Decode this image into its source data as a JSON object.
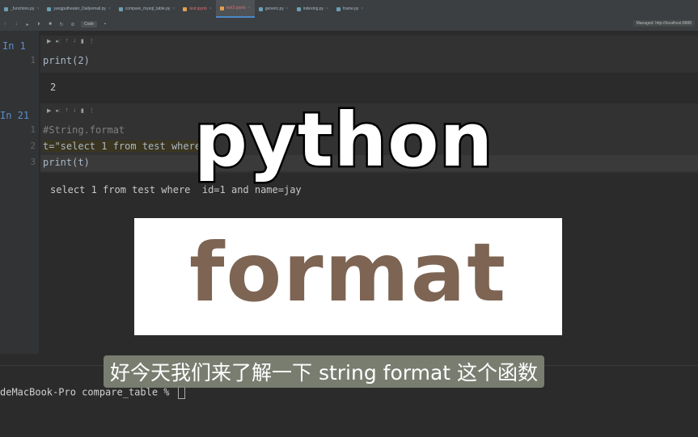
{
  "tabs": [
    {
      "label": "_functions.py",
      "state": "normal"
    },
    {
      "label": "yangputheater_Dailyemail.py",
      "state": "normal"
    },
    {
      "label": "compare_mysql_table.py",
      "state": "normal"
    },
    {
      "label": "test.ipynb",
      "state": "error"
    },
    {
      "label": "test2.ipynb",
      "state": "active"
    },
    {
      "label": "generic.py",
      "state": "normal"
    },
    {
      "label": "indexing.py",
      "state": "normal"
    },
    {
      "label": "frame.py",
      "state": "normal"
    }
  ],
  "toolbar": {
    "kernel_select": "Code",
    "managed_server": "Managed: http://localhost:8888"
  },
  "cells": [
    {
      "prompt": "In 1",
      "lines": [
        {
          "num": "1",
          "text": "print(2)"
        }
      ],
      "output": "2"
    },
    {
      "prompt": "In 21",
      "lines": [
        {
          "num": "1",
          "text": "#String.format"
        },
        {
          "num": "2",
          "text": "t=\"select 1 from test where"
        },
        {
          "num": "3",
          "text": "print(t)"
        }
      ],
      "output": "select 1 from test where  id=1 and name=jay"
    }
  ],
  "overlay": {
    "title_word": "python",
    "banner_word": "format",
    "subtitle": "好今天我们来了解一下 string format 这个函数"
  },
  "terminal": {
    "line": "deMacBook-Pro compare_table % "
  },
  "colors": {
    "accent": "#4a88c7",
    "prompt": "#5c8fc9",
    "banner_text": "#7d6453"
  }
}
